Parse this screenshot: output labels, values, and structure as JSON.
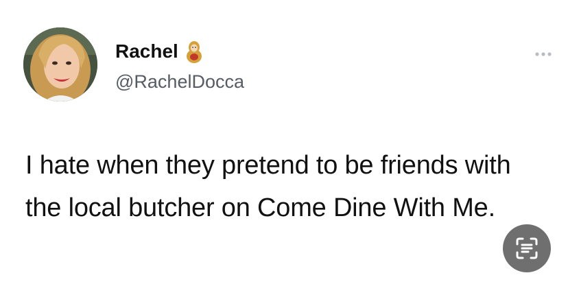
{
  "tweet": {
    "display_name": "Rachel",
    "name_emoji": "nesting-doll-icon",
    "handle": "@RachelDocca",
    "text": "I hate when they pretend to be friends with the local butcher on Come Dine With Me."
  },
  "icons": {
    "more": "more-icon",
    "scan": "text-scan-icon"
  },
  "colors": {
    "background": "#ffffff",
    "text": "#111111",
    "handle": "#555c63",
    "scan_button": "#6f6f6f"
  }
}
